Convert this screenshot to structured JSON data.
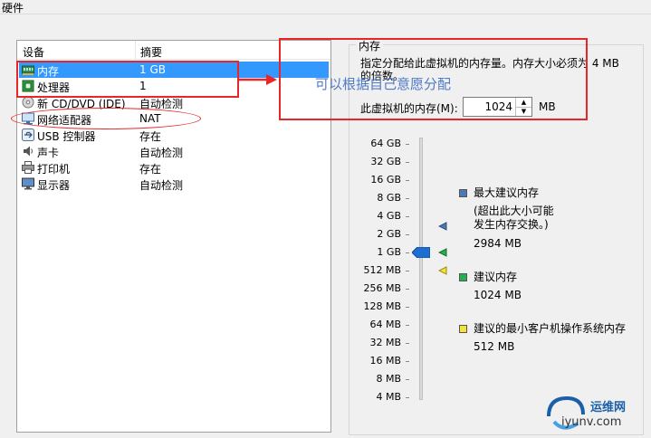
{
  "window": {
    "title": "硬件"
  },
  "device_list": {
    "headers": {
      "device": "设备",
      "summary": "摘要"
    },
    "rows": [
      {
        "name": "内存",
        "summary": "1 GB",
        "icon": "memory-icon"
      },
      {
        "name": "处理器",
        "summary": "1",
        "icon": "processor-icon"
      },
      {
        "name": "新 CD/DVD (IDE)",
        "summary": "自动检测",
        "icon": "cd-dvd-icon"
      },
      {
        "name": "网络适配器",
        "summary": "NAT",
        "icon": "network-adapter-icon"
      },
      {
        "name": "USB 控制器",
        "summary": "存在",
        "icon": "usb-icon"
      },
      {
        "name": "声卡",
        "summary": "自动检测",
        "icon": "sound-card-icon"
      },
      {
        "name": "打印机",
        "summary": "存在",
        "icon": "printer-icon"
      },
      {
        "name": "显示器",
        "summary": "自动检测",
        "icon": "monitor-icon"
      }
    ],
    "selected_index": 0
  },
  "memory_panel": {
    "group_title": "内存",
    "description": "指定分配给此虚拟机的内存量。内存大小必须为 4 MB 的倍数。",
    "memory_label": "此虚拟机的内存(M):",
    "memory_value": "1024",
    "memory_unit": "MB",
    "slider": {
      "ticks": [
        "64 GB",
        "32 GB",
        "16 GB",
        "8 GB",
        "4 GB",
        "2 GB",
        "1 GB",
        "512 MB",
        "256 MB",
        "128 MB",
        "64 MB",
        "32 MB",
        "16 MB",
        "8 MB",
        "4 MB"
      ],
      "current_label": "1 GB",
      "max_recommended_label": "2 GB",
      "recommended_label": "1 GB",
      "min_guest_label": "512 MB"
    },
    "legend": {
      "max": {
        "title": "最大建议内存",
        "note_line1": "(超出此大小可能",
        "note_line2": "发生内存交换。)",
        "value": "2984 MB",
        "color": "#4a79b8"
      },
      "recommended": {
        "title": "建议内存",
        "value": "1024 MB",
        "color": "#22b14c"
      },
      "min_guest": {
        "title": "建议的最小客户机操作系统内存",
        "value": "512 MB",
        "color": "#f5e33a"
      }
    }
  },
  "annotation": {
    "text": "可以根据自己意愿分配",
    "color": "#e8262a"
  },
  "watermark": {
    "title": "运维网",
    "url": "iyunv.com"
  }
}
